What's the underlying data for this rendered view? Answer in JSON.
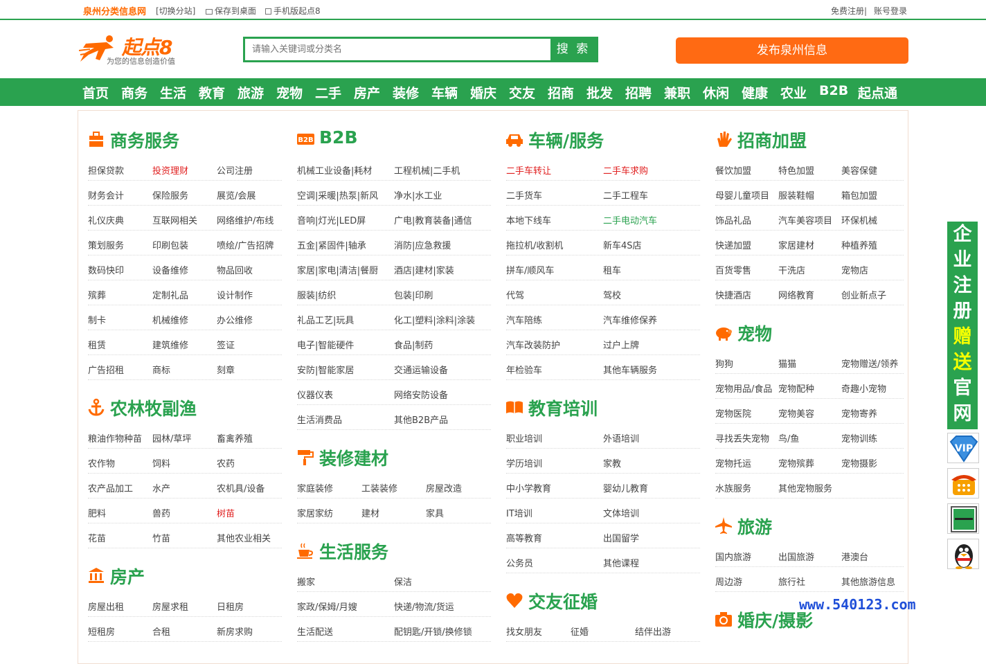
{
  "topbar": {
    "site_name": "泉州分类信息网",
    "switch_label": "[切换分站]",
    "save_desktop": "保存到桌面",
    "mobile_version": "手机版起点8",
    "register": "免费注册|",
    "login": "账号登录"
  },
  "logo": {
    "brand": "起点8",
    "slogan": "为您的信息创造价值"
  },
  "search": {
    "placeholder": "请输入关键词或分类名",
    "button": "搜 索"
  },
  "publish_button": "发布泉州信息",
  "nav": [
    "首页",
    "商务",
    "生活",
    "教育",
    "旅游",
    "宠物",
    "二手",
    "房产",
    "装修",
    "车辆",
    "婚庆",
    "交友",
    "招商",
    "批发",
    "招聘",
    "兼职",
    "休闲",
    "健康",
    "农业",
    "B2B",
    "起点通"
  ],
  "sections": {
    "business": {
      "title": "商务服务",
      "icon": "briefcase-icon",
      "links": [
        "担保贷款",
        "投资理财",
        "公司注册",
        "财务会计",
        "保险服务",
        "展览/会展",
        "礼仪庆典",
        "互联网相关",
        "网络维护/布线",
        "策划服务",
        "印刷包装",
        "喷绘/广告招牌",
        "数码快印",
        "设备维修",
        "物品回收",
        "殡葬",
        "定制礼品",
        "设计制作",
        "制卡",
        "机械维修",
        "办公维修",
        "租赁",
        "建筑维修",
        "签证",
        "广告招租",
        "商标",
        "刻章"
      ]
    },
    "agri": {
      "title": "农林牧副渔",
      "icon": "anchor-icon",
      "links": [
        "粮油作物种苗",
        "园林/草坪",
        "畜禽养殖",
        "农作物",
        "饲料",
        "农药",
        "农产品加工",
        "水产",
        "农机具/设备",
        "肥料",
        "兽药",
        "树苗",
        "花苗",
        "竹苗",
        "其他农业相关"
      ]
    },
    "house": {
      "title": "房产",
      "icon": "bank-icon",
      "links": [
        "房屋出租",
        "房屋求租",
        "日租房",
        "短租房",
        "合租",
        "新房求购"
      ]
    },
    "b2b": {
      "title": "B2B",
      "icon": "b2b-icon",
      "links": [
        "机械工业设备|耗材",
        "工程机械|二手机",
        "空调|采暖|热泵|新风",
        "净水|水工业",
        "音响|灯光|LED屏",
        "广电|教育装备|通信",
        "五金|紧固件|轴承",
        "消防|应急救援",
        "家居|家电|清洁|餐厨",
        "酒店|建材|家装",
        "服装|纺织",
        "包装|印刷",
        "礼品工艺|玩具",
        "化工|塑料|涂料|涂装",
        "电子|智能硬件",
        "食品|制药",
        "安防|智能家居",
        "交通运输设备",
        "仪器仪表",
        "网络安防设备",
        "生活消费品",
        "其他B2B产品"
      ]
    },
    "decor": {
      "title": "装修建材",
      "icon": "paint-roller-icon",
      "links": [
        "家庭装修",
        "工装装修",
        "房屋改造",
        "家居家纺",
        "建材",
        "家具"
      ]
    },
    "life": {
      "title": "生活服务",
      "icon": "coffee-cup-icon",
      "links": [
        "搬家",
        "保洁",
        "家政/保姆/月嫂",
        "快递/物流/货运",
        "生活配送",
        "配钥匙/开锁/换修锁"
      ]
    },
    "vehicle": {
      "title": "车辆/服务",
      "icon": "car-icon",
      "links": [
        "二手车转让",
        "二手车求购",
        "二手货车",
        "二手工程车",
        "本地下线车",
        "二手电动汽车",
        "拖拉机/收割机",
        "新车4S店",
        "拼车/顺风车",
        "租车",
        "代驾",
        "驾校",
        "汽车陪练",
        "汽车维修保养",
        "汽车改装防护",
        "过户上牌",
        "年检验车",
        "其他车辆服务"
      ]
    },
    "edu": {
      "title": "教育培训",
      "icon": "book-icon",
      "links": [
        "职业培训",
        "外语培训",
        "学历培训",
        "家教",
        "中小学教育",
        "婴幼儿教育",
        "IT培训",
        "文体培训",
        "高等教育",
        "出国留学",
        "公务员",
        "其他课程"
      ]
    },
    "dating": {
      "title": "交友征婚",
      "icon": "heart-icon",
      "links": [
        "找女朋友",
        "征婚",
        "结伴出游"
      ]
    },
    "franchise": {
      "title": "招商加盟",
      "icon": "hand-icon",
      "links": [
        "餐饮加盟",
        "特色加盟",
        "美容保健",
        "母婴儿童项目",
        "服装鞋帽",
        "箱包加盟",
        "饰品礼品",
        "汽车美容项目",
        "环保机械",
        "快递加盟",
        "家居建材",
        "种植养殖",
        "百货零售",
        "干洗店",
        "宠物店",
        "快捷酒店",
        "网络教育",
        "创业新点子"
      ]
    },
    "pets": {
      "title": "宠物",
      "icon": "piggy-icon",
      "links": [
        "狗狗",
        "猫猫",
        "宠物赠送/领养",
        "宠物用品/食品",
        "宠物配种",
        "奇趣小宠物",
        "宠物医院",
        "宠物美容",
        "宠物寄养",
        "寻找丢失宠物",
        "鸟/鱼",
        "宠物训练",
        "宠物托运",
        "宠物殡葬",
        "宠物摄影",
        "水族服务",
        "其他宠物服务"
      ]
    },
    "travel": {
      "title": "旅游",
      "icon": "airplane-icon",
      "links": [
        "国内旅游",
        "出国旅游",
        "港澳台",
        "周边游",
        "旅行社",
        "其他旅游信息"
      ]
    },
    "wedding": {
      "title": "婚庆/摄影",
      "icon": "camera-icon",
      "links": []
    }
  },
  "side_banner": [
    "企",
    "业",
    "注",
    "册",
    "赠",
    "送",
    "官",
    "网"
  ],
  "side_icons": [
    "vip-icon",
    "phone-icon",
    "wechat-icon",
    "qq-penguin-icon"
  ],
  "watermark": "www.540123.com"
}
